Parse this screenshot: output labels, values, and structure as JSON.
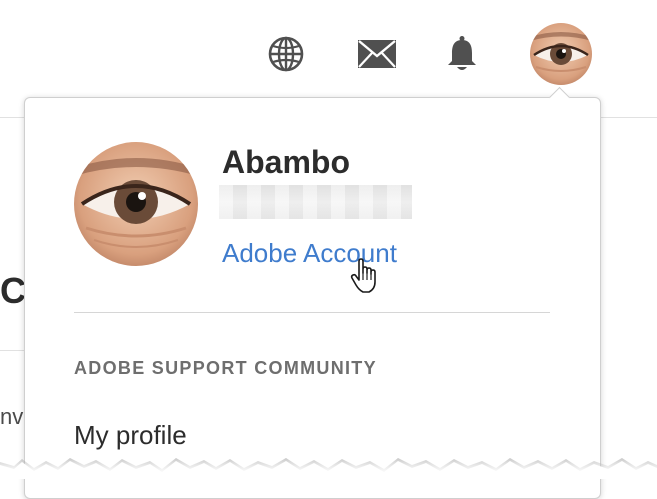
{
  "header": {
    "icons": [
      "globe-icon",
      "mail-icon",
      "bell-icon"
    ],
    "avatar": "user-avatar"
  },
  "background": {
    "partial_heading": "C",
    "partial_text": "nve"
  },
  "profile_menu": {
    "user_name": "Abambo",
    "email_redacted": "",
    "account_link_label": "Adobe Account",
    "section_heading": "ADOBE SUPPORT COMMUNITY",
    "items": [
      {
        "label": "My profile"
      }
    ]
  },
  "colors": {
    "link": "#3f7ccd",
    "heading": "#6e6e6e",
    "text": "#2c2c2c",
    "divider": "#d6d6d6"
  }
}
